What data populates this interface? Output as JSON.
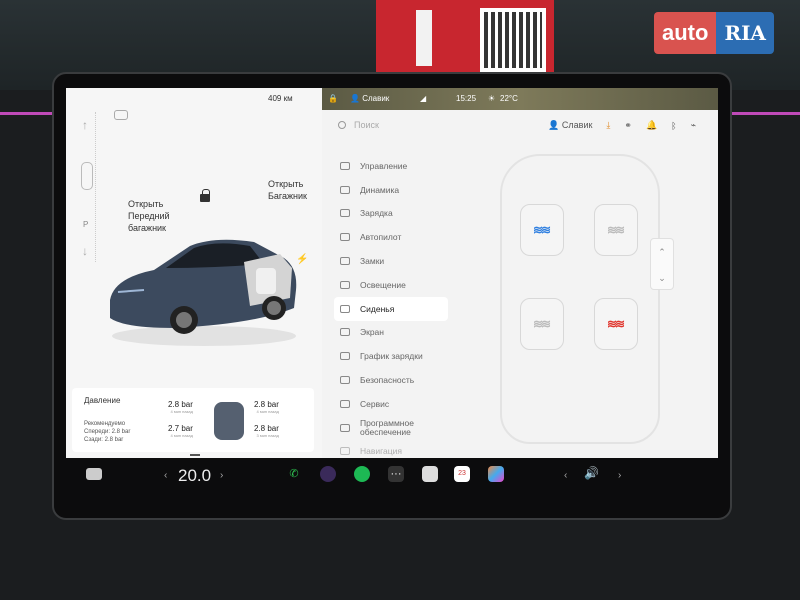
{
  "watermark": {
    "auto": "auto",
    "ria": "RIA"
  },
  "left_panel": {
    "range": "409 км",
    "front_trunk": [
      "Открыть",
      "Передний",
      "багажник"
    ],
    "rear_trunk": [
      "Открыть",
      "Багажник"
    ],
    "gear": "P",
    "pressure": {
      "title": "Давление",
      "recommended": [
        "Рекомендуемо",
        "Спереди: 2.8 bar",
        "Сзади: 2.8 bar"
      ],
      "tires": [
        {
          "value": "2.8 bar",
          "note": "4 мин назад"
        },
        {
          "value": "2.8 bar",
          "note": "4 мин назад"
        },
        {
          "value": "2.7 bar",
          "note": "4 мин назад"
        },
        {
          "value": "2.8 bar",
          "note": "3 мин назад"
        }
      ]
    }
  },
  "statusbar": {
    "user": "Славик",
    "time": "15:25",
    "temp": "22°C"
  },
  "search": {
    "placeholder": "Поиск"
  },
  "profile": {
    "name": "Славик"
  },
  "menu": [
    {
      "label": "Управление",
      "icon": "toggle-icon"
    },
    {
      "label": "Динамика",
      "icon": "car-icon"
    },
    {
      "label": "Зарядка",
      "icon": "bolt-icon"
    },
    {
      "label": "Автопилот",
      "icon": "steering-icon"
    },
    {
      "label": "Замки",
      "icon": "lock-icon"
    },
    {
      "label": "Освещение",
      "icon": "light-icon"
    },
    {
      "label": "Сиденья",
      "icon": "seat-icon",
      "active": true
    },
    {
      "label": "Экран",
      "icon": "display-icon"
    },
    {
      "label": "График зарядки",
      "icon": "schedule-icon"
    },
    {
      "label": "Безопасность",
      "icon": "shield-icon"
    },
    {
      "label": "Сервис",
      "icon": "wrench-icon"
    },
    {
      "label": "Программное обеспечение",
      "icon": "download-icon"
    },
    {
      "label": "Навигация",
      "icon": "nav-icon"
    }
  ],
  "seats": {
    "driver_heat": "blue",
    "rear_right_heat": "red"
  },
  "dock": {
    "temperature": "20.0",
    "calendar_day": "23"
  },
  "colors": {
    "accent_orange": "#e08b2a",
    "heat_blue": "#2f7fe0",
    "heat_red": "#e0352d",
    "brand_red": "#d9534f",
    "brand_blue": "#2c6db3"
  }
}
